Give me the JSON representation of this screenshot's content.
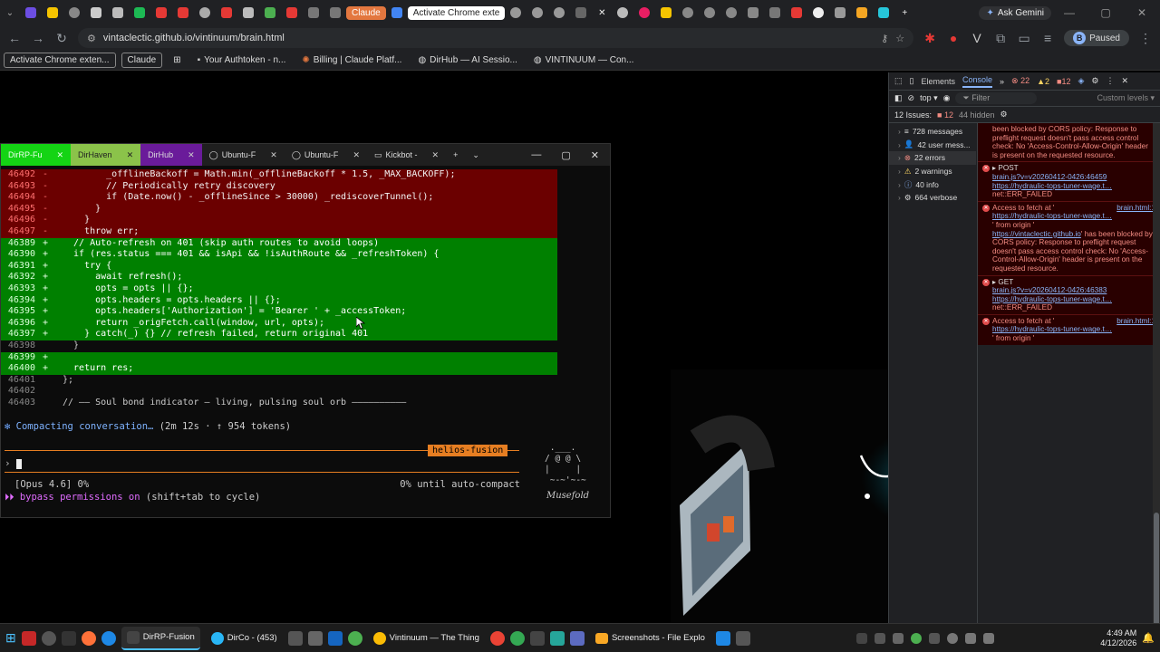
{
  "browser": {
    "tabs": {
      "claude_tab": "Claude",
      "active_ext_tab": "Activate Chrome exte"
    },
    "ask_gemini": "Ask Gemini",
    "url": "vintaclectic.github.io/vintinuum/brain.html",
    "paused": "Paused",
    "profile_initial": "B",
    "bookmarks": [
      "Activate Chrome exten...",
      "Claude",
      "Your Authtoken - n...",
      "Billing | Claude Platf...",
      "DirHub — AI Sessio...",
      "VINTINUUM — Con..."
    ]
  },
  "terminal": {
    "tabs": [
      "DirRP-Fu",
      "DirHaven",
      "DirHub",
      "Ubuntu-F",
      "Ubuntu-F",
      "Kickbot -"
    ],
    "lines": [
      {
        "n": "46492",
        "s": "-",
        "t": "        _offlineBackoff = Math.min(_offlineBackoff * 1.5, _MAX_BACKOFF);",
        "k": "del"
      },
      {
        "n": "46493",
        "s": "-",
        "t": "        // Periodically retry discovery",
        "k": "del"
      },
      {
        "n": "46494",
        "s": "-",
        "t": "        if (Date.now() - _offlineSince > 30000) _rediscoverTunnel();",
        "k": "del"
      },
      {
        "n": "46495",
        "s": "-",
        "t": "      }",
        "k": "del"
      },
      {
        "n": "46496",
        "s": "-",
        "t": "    }",
        "k": "del"
      },
      {
        "n": "46497",
        "s": "-",
        "t": "    throw err;",
        "k": "del"
      },
      {
        "n": "46389",
        "s": "+",
        "t": "  // Auto-refresh on 401 (skip auth routes to avoid loops)",
        "k": "add"
      },
      {
        "n": "46390",
        "s": "+",
        "t": "  if (res.status === 401 && isApi && !isAuthRoute && _refreshToken) {",
        "k": "add"
      },
      {
        "n": "46391",
        "s": "+",
        "t": "    try {",
        "k": "add"
      },
      {
        "n": "46392",
        "s": "+",
        "t": "      await refresh();",
        "k": "add"
      },
      {
        "n": "46393",
        "s": "+",
        "t": "      opts = opts || {};",
        "k": "add"
      },
      {
        "n": "46394",
        "s": "+",
        "t": "      opts.headers = opts.headers || {};",
        "k": "add"
      },
      {
        "n": "46395",
        "s": "+",
        "t": "      opts.headers['Authorization'] = 'Bearer ' + _accessToken;",
        "k": "add"
      },
      {
        "n": "46396",
        "s": "+",
        "t": "      return _origFetch.call(window, url, opts);",
        "k": "add"
      },
      {
        "n": "46397",
        "s": "+",
        "t": "    } catch(_) {} // refresh failed, return original 401",
        "k": "add"
      },
      {
        "n": "46398",
        "s": "",
        "t": "  }",
        "k": "ctx"
      },
      {
        "n": "46399",
        "s": "+",
        "t": "",
        "k": "add"
      },
      {
        "n": "46400",
        "s": "+",
        "t": "  return res;",
        "k": "add"
      },
      {
        "n": "46401",
        "s": "",
        "t": "};",
        "k": "ctx"
      },
      {
        "n": "46402",
        "s": "",
        "t": "",
        "k": "ctx"
      },
      {
        "n": "46403",
        "s": "",
        "t": "// —— Soul bond indicator — living, pulsing soul orb ——————————",
        "k": "ctx"
      }
    ],
    "compacting": "Compacting conversation…",
    "compacting_meta": "(2m 12s · ↑ 954 tokens)",
    "helios_badge": "helios-fusion",
    "prompt_symbol": "›",
    "model_status": "[Opus 4.6] 0%",
    "auto_compact": "0% until auto-compact",
    "bypass": "bypass permissions on",
    "bypass_hint": "(shift+tab to cycle)",
    "owl_art": " .___.\n/ @ @ \\\n|     |\n ~-~'~-~",
    "musefold": "Musefold"
  },
  "devtools": {
    "tabs": [
      "Elements",
      "Console"
    ],
    "error_count": "22",
    "warn_count": "2",
    "issue_count": "12",
    "context": "top",
    "filter_placeholder": "Filter",
    "levels": "Custom levels ▾",
    "issues_label": "12 Issues:",
    "issues_badge": "12",
    "hidden": "44 hidden",
    "sidebar": [
      {
        "icon": "≡",
        "label": "728 messages"
      },
      {
        "icon": "👤",
        "label": "42 user mess..."
      },
      {
        "icon": "⊗",
        "label": "22 errors"
      },
      {
        "icon": "⚠",
        "label": "2 warnings"
      },
      {
        "icon": "ⓘ",
        "label": "40 info"
      },
      {
        "icon": "⚙",
        "label": "664 verbose"
      }
    ],
    "messages": [
      {
        "type": "cont",
        "text": "been blocked by CORS policy: Response to preflight request doesn't pass access control check: No 'Access-Control-Allow-Origin' header is present on the requested resource."
      },
      {
        "type": "net",
        "method": "POST",
        "link1": "brain.js?v=v20260412-0426:46459",
        "link2": "https://hydraulic-tops-tuner-wage.t…",
        "tail": "net::ERR_FAILED"
      },
      {
        "type": "cors",
        "pre": "Access to fetch at '",
        "src": "brain.html:1",
        "link2": "https://hydraulic-tops-tuner-wage.t…",
        "mid": "' from origin '",
        "origin": "https://vintaclectic.github.io",
        "post": "' has been blocked by CORS policy: Response to preflight request doesn't pass access control check: No 'Access-Control-Allow-Origin' header is present on the requested resource."
      },
      {
        "type": "net",
        "method": "GET",
        "link1": "brain.js?v=v20260412-0426:46383",
        "link2": "https://hydraulic-tops-tuner-wage.t…",
        "tail": "net::ERR_FAILED"
      },
      {
        "type": "cors",
        "pre": "Access to fetch at '",
        "src": "brain.html:1",
        "link2": "https://hydraulic-tops-tuner-wage.t…",
        "mid": "' from origin '",
        "origin": "",
        "post": ""
      }
    ]
  },
  "taskbar": {
    "apps": [
      "DirRP-Fusion",
      "DirCo - (453)",
      "Vintinuum — The Thing",
      "Screenshots - File Explo"
    ],
    "time": "4:49 AM",
    "date": "4/12/2026"
  }
}
